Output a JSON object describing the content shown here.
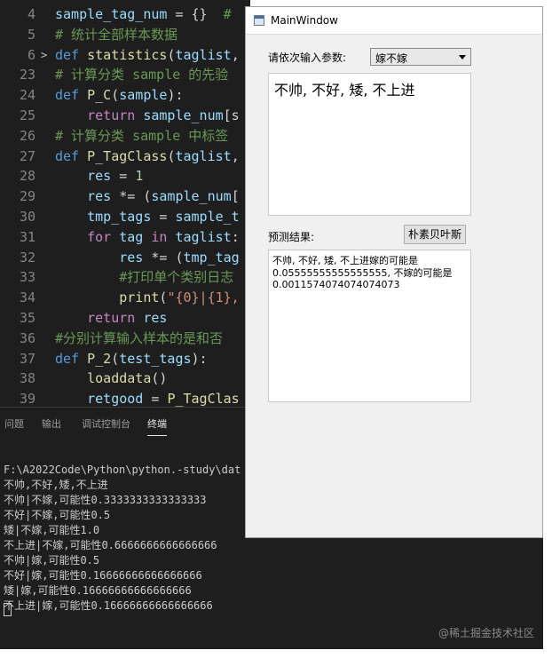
{
  "editor": {
    "lines": [
      {
        "num": "4",
        "fold": "",
        "segments": [
          {
            "c": "var",
            "t": "sample_tag_num"
          },
          {
            "c": "pl",
            "t": " = {}  "
          },
          {
            "c": "cm",
            "t": "#"
          }
        ]
      },
      {
        "num": "5",
        "fold": "",
        "segments": [
          {
            "c": "cm",
            "t": "# 统计全部样本数据"
          }
        ]
      },
      {
        "num": "6",
        "fold": ">",
        "segments": [
          {
            "c": "kw",
            "t": "def "
          },
          {
            "c": "fn",
            "t": "statistics"
          },
          {
            "c": "pl",
            "t": "("
          },
          {
            "c": "var",
            "t": "taglist"
          },
          {
            "c": "pl",
            "t": ","
          }
        ]
      },
      {
        "num": "23",
        "fold": "",
        "segments": [
          {
            "c": "cm",
            "t": "# 计算分类 sample 的先验"
          }
        ]
      },
      {
        "num": "24",
        "fold": "",
        "segments": [
          {
            "c": "kw",
            "t": "def "
          },
          {
            "c": "fn",
            "t": "P_C"
          },
          {
            "c": "pl",
            "t": "("
          },
          {
            "c": "var",
            "t": "sample"
          },
          {
            "c": "pl",
            "t": "):"
          }
        ]
      },
      {
        "num": "25",
        "fold": "",
        "segments": [
          {
            "c": "pl",
            "t": "    "
          },
          {
            "c": "kw2",
            "t": "return "
          },
          {
            "c": "var",
            "t": "sample_num"
          },
          {
            "c": "pl",
            "t": "[s"
          }
        ]
      },
      {
        "num": "26",
        "fold": "",
        "segments": [
          {
            "c": "cm",
            "t": "# 计算分类 sample 中标签"
          }
        ]
      },
      {
        "num": "27",
        "fold": "",
        "segments": [
          {
            "c": "kw",
            "t": "def "
          },
          {
            "c": "fn",
            "t": "P_TagClass"
          },
          {
            "c": "pl",
            "t": "("
          },
          {
            "c": "var",
            "t": "taglist"
          },
          {
            "c": "pl",
            "t": ","
          }
        ]
      },
      {
        "num": "28",
        "fold": "",
        "segments": [
          {
            "c": "pl",
            "t": "    "
          },
          {
            "c": "var",
            "t": "res"
          },
          {
            "c": "pl",
            "t": " = "
          },
          {
            "c": "num",
            "t": "1"
          }
        ]
      },
      {
        "num": "29",
        "fold": "",
        "segments": [
          {
            "c": "pl",
            "t": "    "
          },
          {
            "c": "var",
            "t": "res"
          },
          {
            "c": "pl",
            "t": " *= ("
          },
          {
            "c": "var",
            "t": "sample_num"
          },
          {
            "c": "pl",
            "t": "["
          }
        ]
      },
      {
        "num": "30",
        "fold": "",
        "segments": [
          {
            "c": "pl",
            "t": "    "
          },
          {
            "c": "var",
            "t": "tmp_tags"
          },
          {
            "c": "pl",
            "t": " = "
          },
          {
            "c": "var",
            "t": "sample_t"
          }
        ]
      },
      {
        "num": "31",
        "fold": "",
        "segments": [
          {
            "c": "pl",
            "t": "    "
          },
          {
            "c": "kw2",
            "t": "for "
          },
          {
            "c": "var",
            "t": "tag"
          },
          {
            "c": "kw2",
            "t": " in "
          },
          {
            "c": "var",
            "t": "taglist"
          },
          {
            "c": "pl",
            "t": ":"
          }
        ]
      },
      {
        "num": "32",
        "fold": "",
        "segments": [
          {
            "c": "pl",
            "t": "        "
          },
          {
            "c": "var",
            "t": "res"
          },
          {
            "c": "pl",
            "t": " *= ("
          },
          {
            "c": "var",
            "t": "tmp_tag"
          }
        ]
      },
      {
        "num": "33",
        "fold": "",
        "segments": [
          {
            "c": "pl",
            "t": "        "
          },
          {
            "c": "cm",
            "t": "#打印单个类别日志"
          }
        ]
      },
      {
        "num": "34",
        "fold": "",
        "segments": [
          {
            "c": "pl",
            "t": "        "
          },
          {
            "c": "fn",
            "t": "print"
          },
          {
            "c": "pl",
            "t": "("
          },
          {
            "c": "str",
            "t": "\"{0}|{1},"
          }
        ]
      },
      {
        "num": "35",
        "fold": "",
        "segments": [
          {
            "c": "pl",
            "t": "    "
          },
          {
            "c": "kw2",
            "t": "return "
          },
          {
            "c": "var",
            "t": "res"
          }
        ]
      },
      {
        "num": "36",
        "fold": "",
        "segments": [
          {
            "c": "cm",
            "t": "#分别计算输入样本的是和否"
          }
        ]
      },
      {
        "num": "37",
        "fold": "",
        "segments": [
          {
            "c": "kw",
            "t": "def "
          },
          {
            "c": "fn",
            "t": "P_2"
          },
          {
            "c": "pl",
            "t": "("
          },
          {
            "c": "var",
            "t": "test_tags"
          },
          {
            "c": "pl",
            "t": "):"
          }
        ]
      },
      {
        "num": "38",
        "fold": "",
        "segments": [
          {
            "c": "pl",
            "t": "    "
          },
          {
            "c": "fn",
            "t": "loaddata"
          },
          {
            "c": "pl",
            "t": "()"
          }
        ]
      },
      {
        "num": "39",
        "fold": "",
        "segments": [
          {
            "c": "pl",
            "t": "    "
          },
          {
            "c": "var",
            "t": "retgood"
          },
          {
            "c": "pl",
            "t": " = "
          },
          {
            "c": "fn",
            "t": "P_TagClas"
          }
        ]
      }
    ]
  },
  "panel": {
    "tabs": [
      "问题",
      "输出",
      "调试控制台",
      "终端"
    ],
    "active_tab": 3,
    "terminal_lines": [
      "F:\\A2022Code\\Python\\python.-study\\dat",
      "不帅,不好,矮,不上进",
      "不帅|不嫁,可能性0.3333333333333333",
      "不好|不嫁,可能性0.5",
      "矮|不嫁,可能性1.0",
      "不上进|不嫁,可能性0.6666666666666666",
      "不帅|嫁,可能性0.5",
      "不好|嫁,可能性0.16666666666666666",
      "矮|嫁,可能性0.16666666666666666",
      "不上进|嫁,可能性0.16666666666666666"
    ],
    "watermark": "@稀土掘金技术社区"
  },
  "window": {
    "title": "MainWindow",
    "param_label": "请依次输入参数:",
    "combo_value": "嫁不嫁",
    "input_text": "不帅, 不好, 矮, 不上进",
    "result_label": "预测结果:",
    "button_label": "朴素贝叶斯",
    "result_lines": [
      "不帅, 不好, 矮, 不上进嫁的可能是",
      "0.05555555555555555, 不嫁的可能是",
      "0.0011574074074074073"
    ]
  }
}
